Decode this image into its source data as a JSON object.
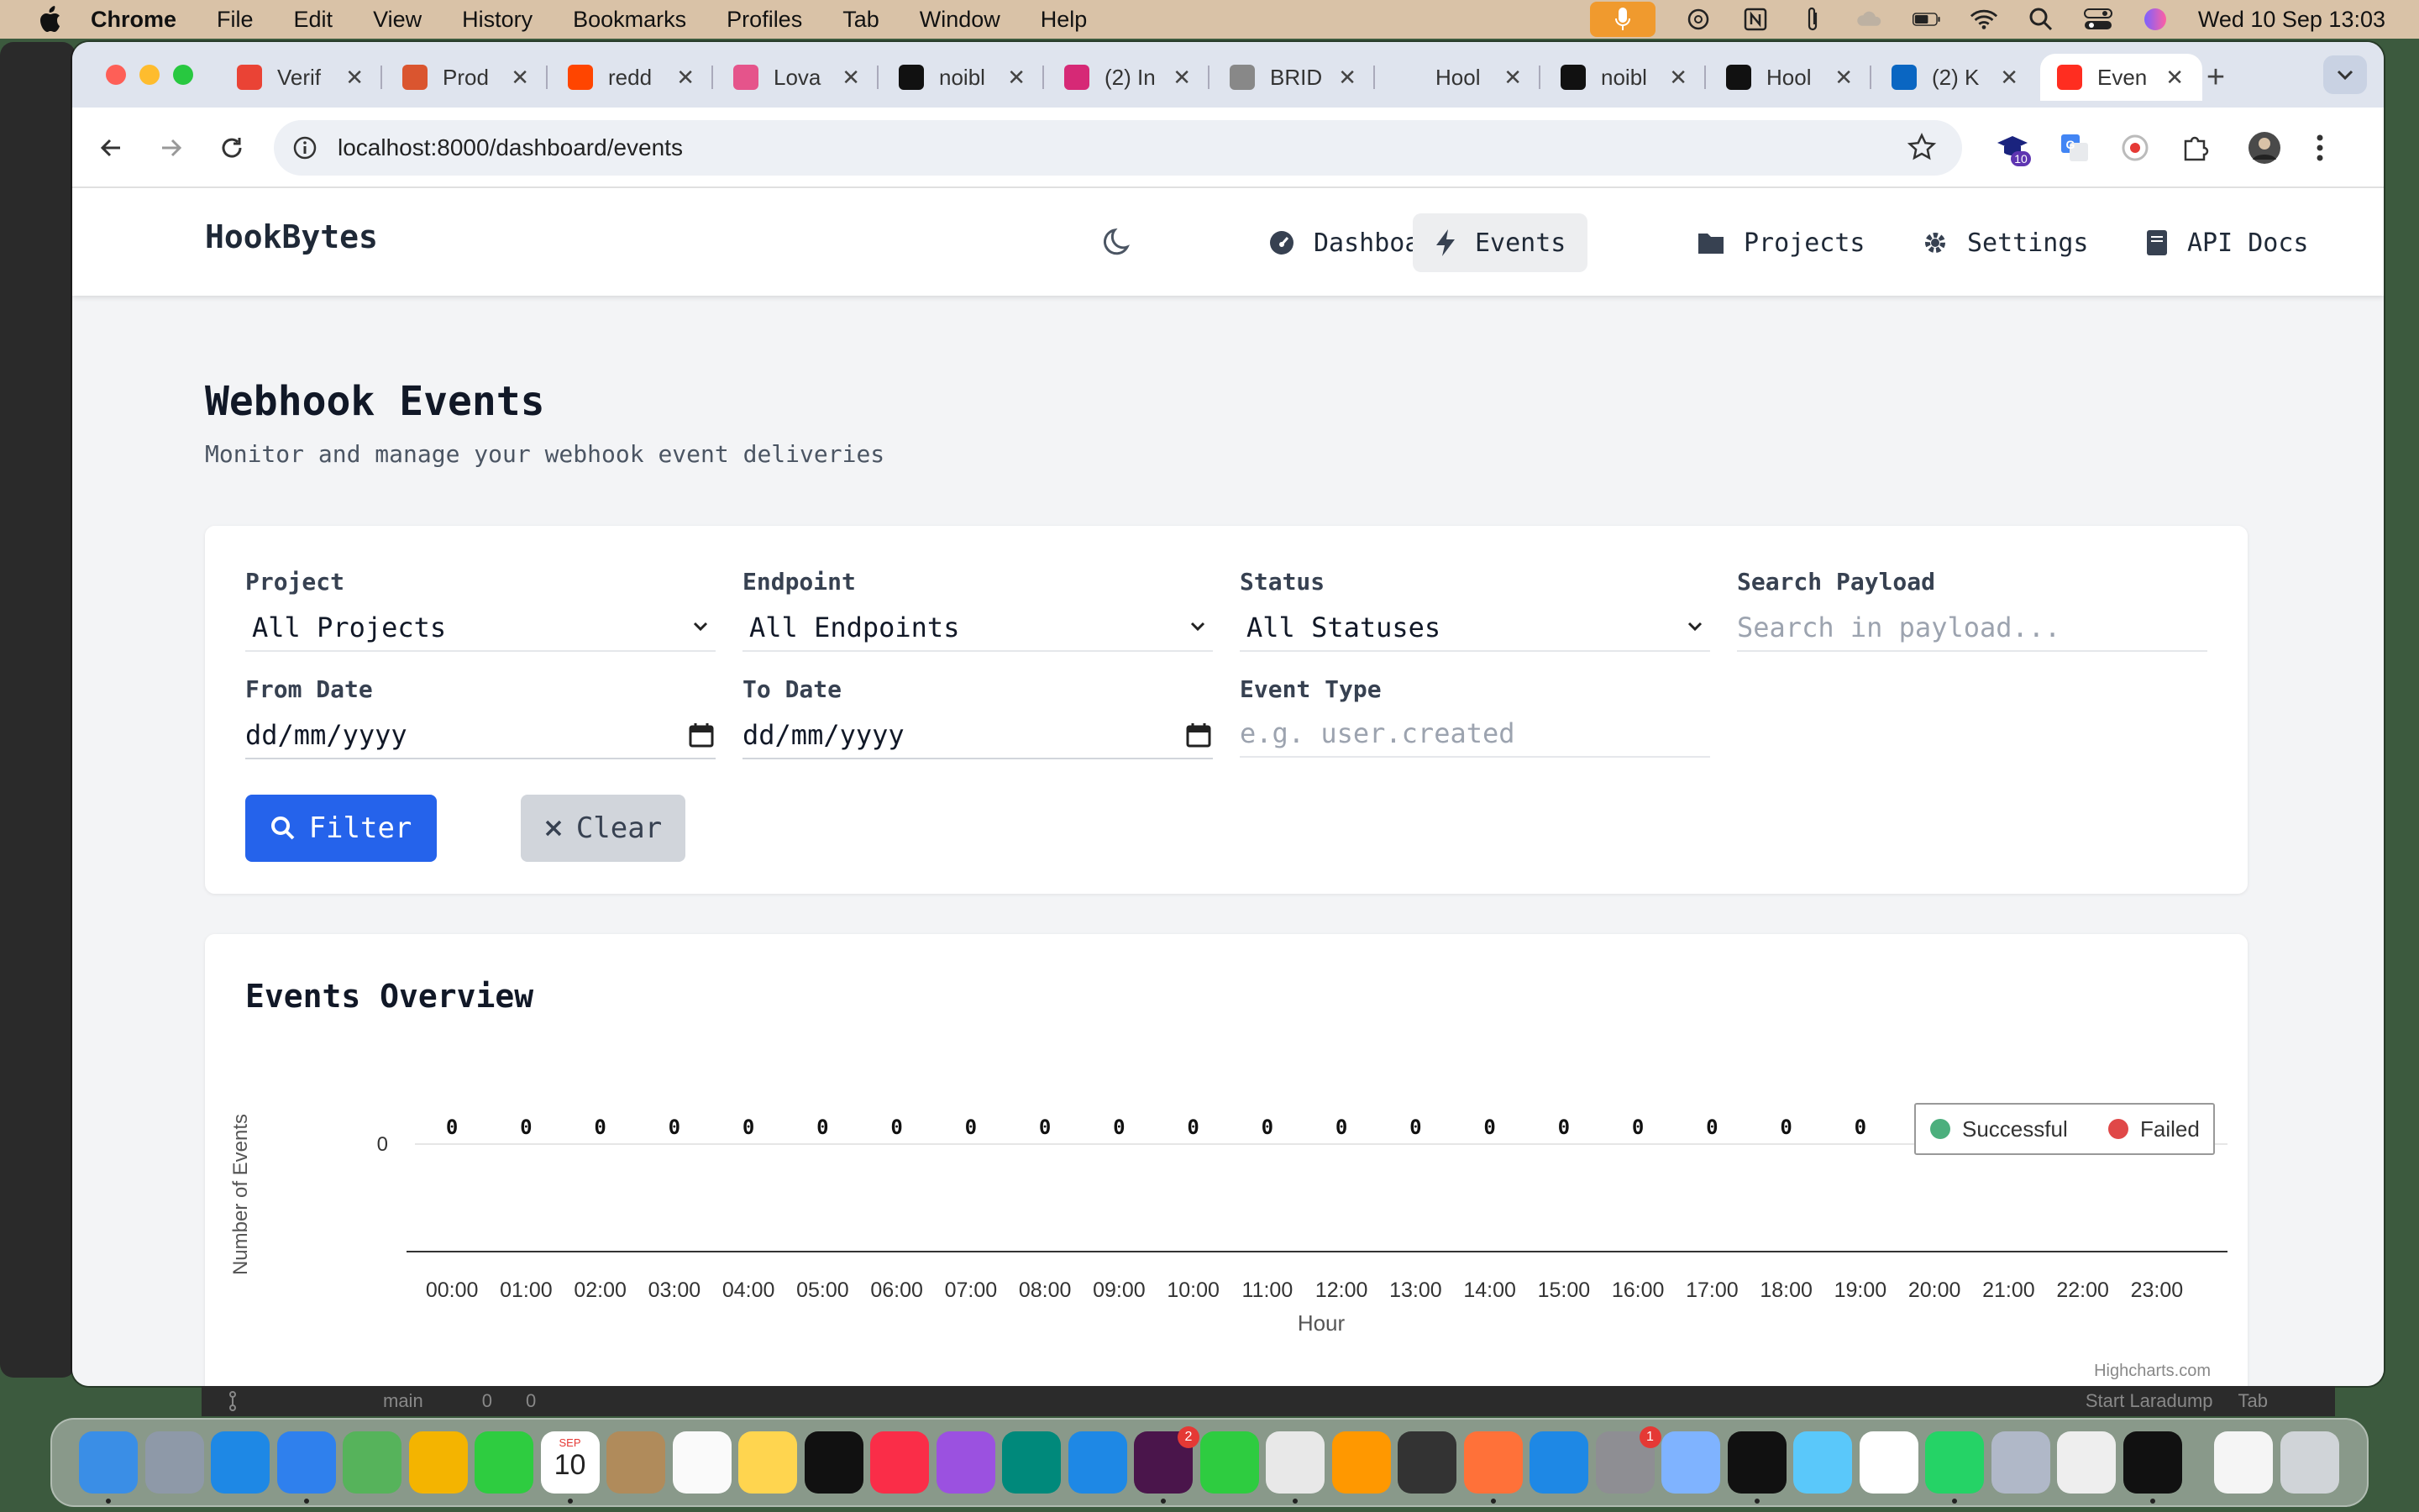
{
  "menubar": {
    "app_name": "Chrome",
    "items": [
      "File",
      "Edit",
      "View",
      "History",
      "Bookmarks",
      "Profiles",
      "Tab",
      "Window",
      "Help"
    ],
    "clock": "Wed 10 Sep  13:03"
  },
  "browser": {
    "tabs": [
      {
        "label": "Verif",
        "icon": "gmail-icon",
        "color": "#ea4335"
      },
      {
        "label": "Prod",
        "icon": "producthunt-icon",
        "color": "#da552f"
      },
      {
        "label": "redd",
        "icon": "reddit-icon",
        "color": "#ff4500"
      },
      {
        "label": "Lova",
        "icon": "lovable-icon",
        "color": "#e5548b"
      },
      {
        "label": "noibl",
        "icon": "github-icon",
        "color": "#111111"
      },
      {
        "label": "(2) In",
        "icon": "instagram-icon",
        "color": "#d62976"
      },
      {
        "label": "BRID",
        "icon": "bridge-icon",
        "color": "#888888"
      },
      {
        "label": "Hool",
        "icon": "blank-icon",
        "color": "#dfe4ee"
      },
      {
        "label": "noibl",
        "icon": "github-icon",
        "color": "#111111"
      },
      {
        "label": "Hool",
        "icon": "github-icon",
        "color": "#111111"
      },
      {
        "label": "(2) K",
        "icon": "linkedin-icon",
        "color": "#0a66c2"
      },
      {
        "label": "Even",
        "icon": "laravel-icon",
        "color": "#ff2d20",
        "active": true
      }
    ],
    "url": "localhost:8000/dashboard/events",
    "extension_badge": "10"
  },
  "app": {
    "brand": "HookBytes",
    "nav": {
      "dashboard": "Dashboard",
      "events": "Events",
      "projects": "Projects",
      "settings": "Settings",
      "api_docs": "API Docs"
    },
    "page_title": "Webhook Events",
    "page_subtitle": "Monitor and manage your webhook event deliveries",
    "filters": {
      "project_label": "Project",
      "project_value": "All Projects",
      "endpoint_label": "Endpoint",
      "endpoint_value": "All Endpoints",
      "status_label": "Status",
      "status_value": "All Statuses",
      "search_label": "Search Payload",
      "search_placeholder": "Search in payload...",
      "from_label": "From Date",
      "from_value": "dd/mm/yyyy",
      "to_label": "To Date",
      "to_value": "dd/mm/yyyy",
      "event_type_label": "Event Type",
      "event_type_placeholder": "e.g. user.created",
      "filter_button": "Filter",
      "clear_button": "Clear"
    },
    "chart_title": "Events Overview",
    "chart_credit": "Highcharts.com"
  },
  "chart_data": {
    "type": "bar",
    "categories": [
      "00:00",
      "01:00",
      "02:00",
      "03:00",
      "04:00",
      "05:00",
      "06:00",
      "07:00",
      "08:00",
      "09:00",
      "10:00",
      "11:00",
      "12:00",
      "13:00",
      "14:00",
      "15:00",
      "16:00",
      "17:00",
      "18:00",
      "19:00",
      "20:00",
      "21:00",
      "22:00",
      "23:00"
    ],
    "series": [
      {
        "name": "Successful",
        "color": "#4caf7d",
        "values": [
          0,
          0,
          0,
          0,
          0,
          0,
          0,
          0,
          0,
          0,
          0,
          0,
          0,
          0,
          0,
          0,
          0,
          0,
          0,
          0,
          0,
          0,
          0,
          0
        ]
      },
      {
        "name": "Failed",
        "color": "#e04848",
        "values": [
          0,
          0,
          0,
          0,
          0,
          0,
          0,
          0,
          0,
          0,
          0,
          0,
          0,
          0,
          0,
          0,
          0,
          0,
          0,
          0,
          0,
          0,
          0,
          0
        ]
      }
    ],
    "xlabel": "Hour",
    "ylabel": "Number of Events",
    "yticks": [
      0
    ],
    "data_labels": true,
    "legend_position": "top-right"
  },
  "status_bar": {
    "branch": "main",
    "errors": "0",
    "warnings": "0",
    "right_items": [
      "Start Laradump",
      "Tab"
    ]
  },
  "dock": {
    "calendar_day": "10",
    "calendar_month": "SEP",
    "badges": {
      "slack": "2",
      "settings": "1"
    }
  }
}
